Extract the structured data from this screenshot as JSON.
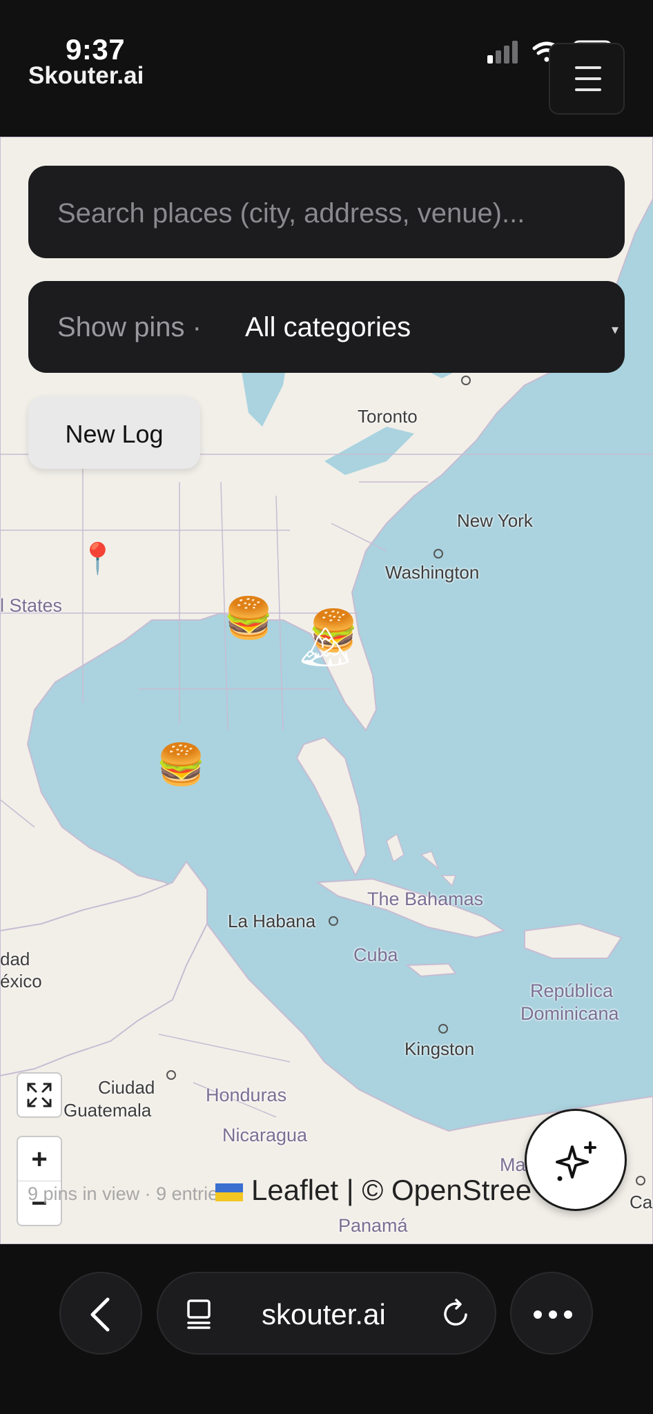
{
  "status": {
    "time": "9:37",
    "app_title": "Skouter.ai"
  },
  "header": {
    "menu_icon": "hamburger-menu-icon"
  },
  "search": {
    "placeholder": "Search places (city, address, venue)..."
  },
  "filter": {
    "prefix": "Show pins · ",
    "value": "All categories",
    "caret": "▾"
  },
  "actions": {
    "new_log": "New Log"
  },
  "map": {
    "labels": {
      "toronto": "Toronto",
      "new_york": "New York",
      "washington": "Washington",
      "united_states": "l States",
      "the_bahamas": "The Bahamas",
      "la_habana": "La Habana",
      "cuba": "Cuba",
      "republica": "República",
      "dominicana": "Dominicana",
      "kingston": "Kingston",
      "ciudad_guatemala_1": "Ciudad",
      "ciudad_guatemala_2": "Guatemala",
      "honduras": "Honduras",
      "nicaragua": "Nicaragua",
      "panama": "Panamá",
      "mexico_1": "dad",
      "mexico_2": "éxico",
      "ma": "Ma",
      "carac": "Carac"
    },
    "pins": [
      {
        "type": "location-pin",
        "glyph": "📍"
      },
      {
        "type": "burger",
        "glyph": "🍔"
      },
      {
        "type": "burger",
        "glyph": "🍔"
      },
      {
        "type": "mountain",
        "glyph": "🏔"
      },
      {
        "type": "burger",
        "glyph": "🍔"
      }
    ],
    "pins_in_view": "9 pins in view · 9 entries",
    "attribution": "Leaflet | © OpenStree",
    "zoom_in": "+",
    "zoom_out": "−"
  },
  "browser": {
    "url": "skouter.ai"
  }
}
